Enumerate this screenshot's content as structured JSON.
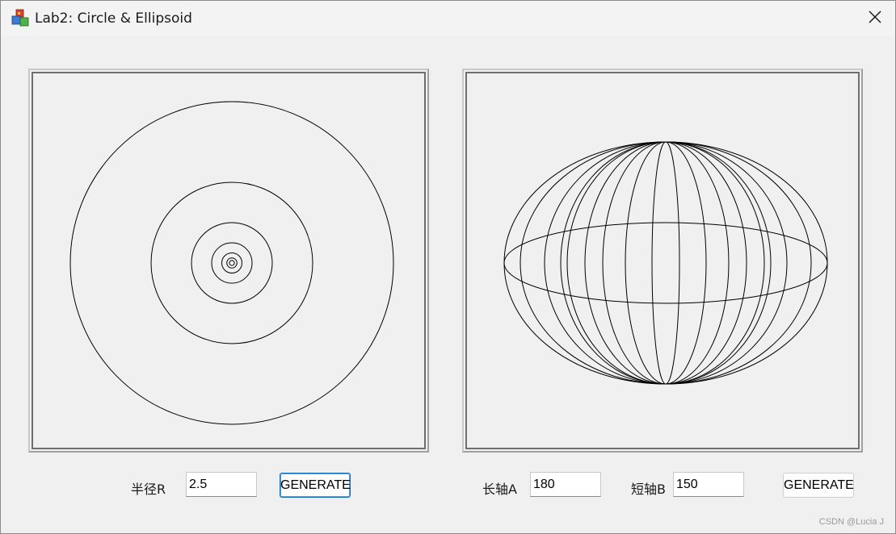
{
  "window": {
    "title": "Lab2: Circle & Ellipsoid",
    "icon": "app-cubes-icon",
    "close_icon": "close-icon"
  },
  "circle_panel": {
    "radius_label": "半径R",
    "radius_value": "2.5",
    "generate_label": "GENERATE"
  },
  "ellipsoid_panel": {
    "major_axis_label": "长轴A",
    "major_axis_value": "180",
    "minor_axis_label": "短轴B",
    "minor_axis_value": "150",
    "generate_label": "GENERATE"
  },
  "watermark": "CSDN @Lucia J"
}
